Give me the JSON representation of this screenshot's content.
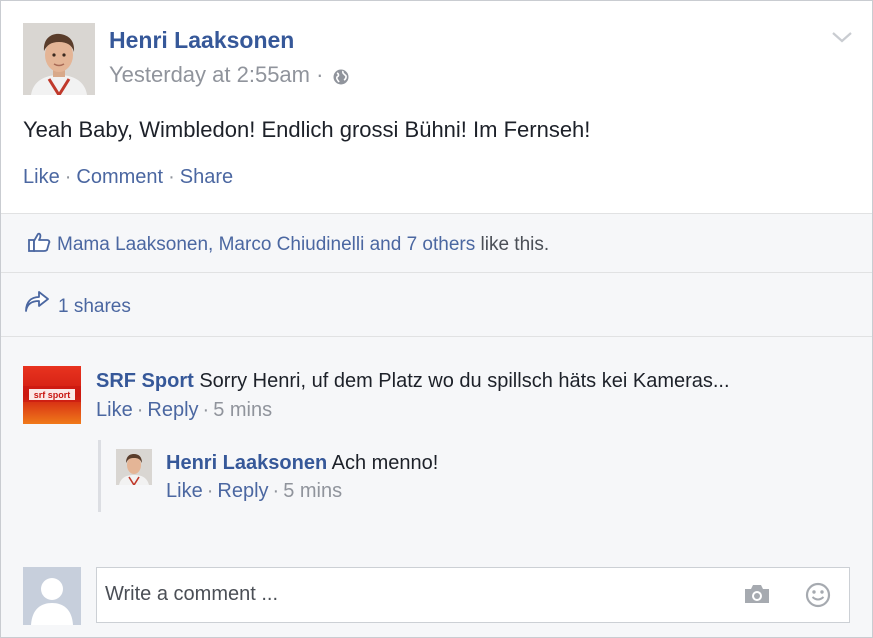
{
  "post": {
    "author": "Henri Laaksonen",
    "timestamp": "Yesterday at 2:55am",
    "meta_separator": "·",
    "text": "Yeah Baby, Wimbledon! Endlich grossi Bühni! Im Fernseh!",
    "actions": {
      "like": "Like",
      "comment": "Comment",
      "share": "Share",
      "separator": "·"
    }
  },
  "likes": {
    "names": "Mama Laaksonen, Marco Chiudinelli and 7 others",
    "suffix": "like this."
  },
  "shares": {
    "label": "1 shares"
  },
  "comments": [
    {
      "author": "SRF Sport",
      "text": "Sorry Henri, uf dem Platz wo du spillsch häts kei Kameras...",
      "like": "Like",
      "reply": "Reply",
      "time": "5 mins",
      "separator": "·",
      "avatar_logo_text": "srf sport",
      "replies": [
        {
          "author": "Henri Laaksonen",
          "text": "Ach menno!",
          "like": "Like",
          "reply": "Reply",
          "time": "5 mins",
          "separator": "·"
        }
      ]
    }
  ],
  "composer": {
    "placeholder": "Write a comment ..."
  },
  "icons": {
    "globe": "globe-icon",
    "chevron": "chevron-down-icon",
    "like": "thumbs-up-icon",
    "share": "share-arrow-icon",
    "camera": "camera-icon",
    "emoji": "smiley-icon"
  },
  "colors": {
    "link": "#365899",
    "action": "#4b67a1",
    "muted": "#90949c",
    "panel": "#f6f7f9",
    "border": "#c9ccd1"
  }
}
